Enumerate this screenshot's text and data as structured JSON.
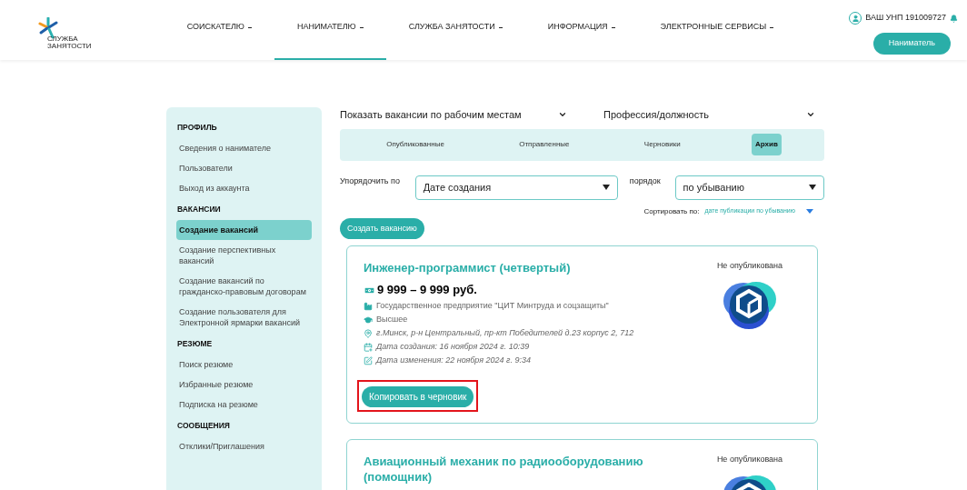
{
  "header": {
    "logo_text": [
      "СЛУЖБА",
      "ЗАНЯТОСТИ"
    ],
    "nav": [
      {
        "label": "СОИСКАТЕЛЮ",
        "selected": false
      },
      {
        "label": "НАНИМАТЕЛЮ",
        "selected": true
      },
      {
        "label": "СЛУЖБА ЗАНЯТОСТИ",
        "selected": false
      },
      {
        "label": "ИНФОРМАЦИЯ",
        "selected": false
      },
      {
        "label": "ЭЛЕКТРОННЫЕ СЕРВИСЫ",
        "selected": false
      }
    ],
    "account": "ВАШ УНП 191009727",
    "role_button": "Наниматель"
  },
  "sidebar": [
    {
      "kind": "heading",
      "label": "ПРОФИЛЬ"
    },
    {
      "kind": "link",
      "label": "Сведения о нанимателе",
      "selected": false
    },
    {
      "kind": "link",
      "label": "Пользователи",
      "selected": false
    },
    {
      "kind": "link",
      "label": "Выход из аккаунта",
      "selected": false
    },
    {
      "kind": "heading",
      "label": "ВАКАНСИИ"
    },
    {
      "kind": "link",
      "label": "Создание вакансий",
      "selected": true
    },
    {
      "kind": "link",
      "label": "Создание перспективных вакансий",
      "selected": false
    },
    {
      "kind": "link",
      "label": "Создание вакансий по гражданско-правовым договорам",
      "selected": false
    },
    {
      "kind": "link",
      "label": "Создание пользователя для Электронной ярмарки вакансий",
      "selected": false
    },
    {
      "kind": "heading",
      "label": "РЕЗЮМЕ"
    },
    {
      "kind": "link",
      "label": "Поиск резюме",
      "selected": false
    },
    {
      "kind": "link",
      "label": "Избранные резюме",
      "selected": false
    },
    {
      "kind": "link",
      "label": "Подписка на резюме",
      "selected": false
    },
    {
      "kind": "heading",
      "label": "СООБЩЕНИЯ"
    },
    {
      "kind": "link",
      "label": "Отклики/Приглашения",
      "selected": false
    }
  ],
  "filters": {
    "workplaces": "Показать вакансии по рабочим местам",
    "profession": "Профессия/должность"
  },
  "tabs": [
    {
      "label": "Опубликованные",
      "selected": false
    },
    {
      "label": "Отправленные",
      "selected": false
    },
    {
      "label": "Черновики",
      "selected": false
    },
    {
      "label": "Архив",
      "selected": true
    }
  ],
  "order_by": {
    "label": "Упорядочить по",
    "value": "Дате создания"
  },
  "order": {
    "label": "порядок",
    "value": "по убыванию"
  },
  "sort": {
    "label": "Сортировать по:",
    "value": "дате публикации по убыванию"
  },
  "create_button": "Создать вакансию",
  "vacancies": [
    {
      "title": "Инженер-программист (четвертый)",
      "status": "Не опубликована",
      "salary": "9 999 – 9 999 руб.",
      "employer": "Государственное предприятие \"ЦИТ Минтруда и соцзащиты\"",
      "education": "Высшее",
      "address": "г.Минск, р-н Центральный, пр-кт Победителей д.23 корпус 2, 712",
      "created": "Дата создания: 16 ноября 2024 г. 10:39",
      "modified": "Дата изменения: 22 ноября 2024 г. 9:34",
      "action": "Копировать в черновик",
      "highlighted": true
    },
    {
      "title": "Авиационный механик по радиооборудованию (помощник)",
      "status": "Не опубликована"
    }
  ]
}
